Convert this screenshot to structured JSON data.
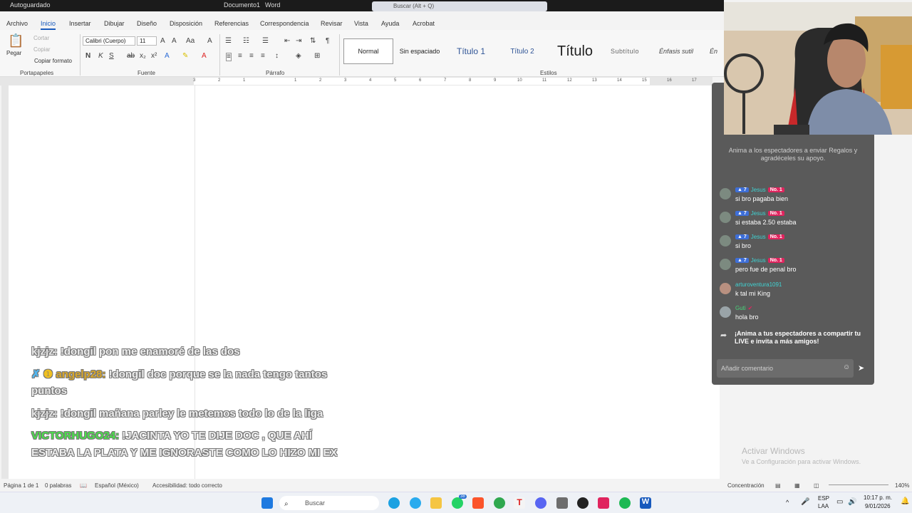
{
  "titlebar": {
    "autosave": "Autoguardado",
    "document": "Documento1",
    "app": "Word",
    "search": "Buscar (Alt + Q)"
  },
  "menu": [
    "Archivo",
    "Inicio",
    "Insertar",
    "Dibujar",
    "Diseño",
    "Disposición",
    "Referencias",
    "Correspondencia",
    "Revisar",
    "Vista",
    "Ayuda",
    "Acrobat"
  ],
  "ribbon": {
    "clipboard": {
      "paste": "Pegar",
      "cut": "Cortar",
      "copy": "Copiar",
      "format_painter": "Copiar formato",
      "label": "Portapapeles"
    },
    "font": {
      "family": "Calibri (Cuerpo)",
      "size": "11",
      "label": "Fuente"
    },
    "paragraph": {
      "label": "Párrafo"
    },
    "styles": {
      "label": "Estilos",
      "items": [
        "Normal",
        "Sin espaciado",
        "Título 1",
        "Título 2",
        "Título",
        "Subtítulo",
        "Énfasis sutil",
        "Én"
      ]
    }
  },
  "ruler": {
    "ticks": [
      "3",
      "2",
      "1",
      "1",
      "2",
      "3",
      "4",
      "5",
      "6",
      "7",
      "8",
      "9",
      "10",
      "11",
      "12",
      "13",
      "14",
      "15",
      "16",
      "17"
    ]
  },
  "overlay_chat": [
    {
      "user": "kjzjz:",
      "text": " !dongil pon me enamoré de las dos"
    },
    {
      "user": "angelp28:",
      "text": " !dongil doc porque se la nada tengo tantos",
      "line2": "puntos"
    },
    {
      "user": "kjzjz:",
      "text": " !dongil mañana parley le metemos todo lo de la liga"
    },
    {
      "user": "VICTORHUGO24:",
      "text": " !JACINTA YO TE DIJE DOC , QUE AHÍ",
      "line2": "ESTABA LA PLATA Y ME IGNORASTE COMO LO HIZO MI EX"
    }
  ],
  "live": {
    "notice": "Anima a los espectadores a enviar Regalos y agradéceles su apoyo.",
    "messages": [
      {
        "level": "7",
        "name": "Jesus",
        "fan": "No. 1",
        "text": "si bro pagaba bien"
      },
      {
        "level": "7",
        "name": "Jesus",
        "fan": "No. 1",
        "text": "si estaba 2.50 estaba"
      },
      {
        "level": "7",
        "name": "Jesus",
        "fan": "No. 1",
        "text": "si bro"
      },
      {
        "level": "7",
        "name": "Jesus",
        "fan": "No. 1",
        "text": "pero fue de penal bro"
      },
      {
        "level": "",
        "name": "arturoventura1091",
        "fan": "",
        "text": "k tal mi King"
      },
      {
        "level": "",
        "name": "Guti",
        "fan": "",
        "text": "hola bro"
      }
    ],
    "share_prompt_1": "¡Anima a tus espectadores a compartir tu",
    "share_prompt_2": "LIVE e invita a más amigos!",
    "comment_placeholder": "Añadir comentario"
  },
  "watermark": {
    "title": "Activar Windows",
    "subtitle": "Ve a Configuración para activar Windows."
  },
  "status": {
    "page": "Página 1 de 1",
    "words": "0 palabras",
    "language": "Español (México)",
    "accessibility": "Accesibilidad: todo correcto",
    "focus": "Concentración",
    "zoom": "140%"
  },
  "taskbar": {
    "search": "Buscar",
    "lang1": "ESP",
    "lang2": "LAA",
    "time": "10:17 p. m.",
    "date": "9/01/2026",
    "whatsapp_badge": "38"
  }
}
